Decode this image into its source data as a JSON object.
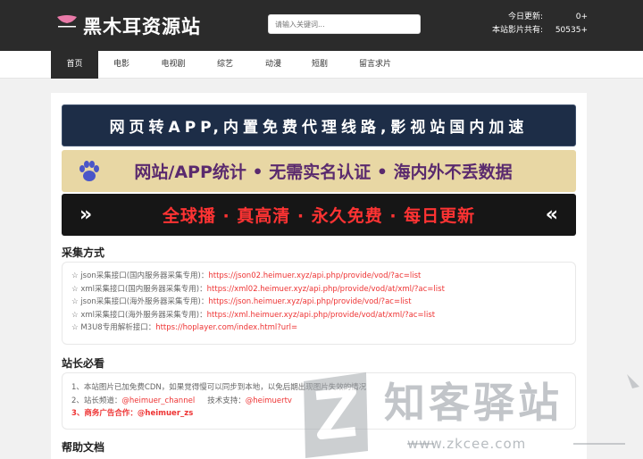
{
  "header": {
    "site_name": "黑木耳资源站",
    "logo_caption": "黑木耳",
    "search_placeholder": "请输入关键词...",
    "stats": [
      {
        "label": "今日更新:",
        "value": "0+"
      },
      {
        "label": "本站影片共有:",
        "value": "50535+"
      }
    ]
  },
  "nav": {
    "items": [
      {
        "label": "首页",
        "active": true
      },
      {
        "label": "电影",
        "active": false
      },
      {
        "label": "电视剧",
        "active": false
      },
      {
        "label": "综艺",
        "active": false
      },
      {
        "label": "动漫",
        "active": false
      },
      {
        "label": "短剧",
        "active": false
      },
      {
        "label": "留言求片",
        "active": false
      }
    ]
  },
  "banners": {
    "b1": "网页转APP,内置免费代理线路,影视站国内加速",
    "b2": "网站/APP统计 • 无需实名认证 • 海内外不丢数据",
    "b3": "全球播 · 真高清 · 永久免费 · 每日更新",
    "b3_left": "»",
    "b3_right": "«"
  },
  "collect": {
    "title": "采集方式",
    "lines": [
      {
        "prefix": "☆ json采集接口(国内服务器采集专用)：",
        "link": "https://json02.heimuer.xyz/api.php/provide/vod/?ac=list"
      },
      {
        "prefix": "☆ xml采集接口(国内服务器采集专用)：",
        "link": "https://xml02.heimuer.xyz/api.php/provide/vod/at/xml/?ac=list"
      },
      {
        "prefix": "☆ json采集接口(海外服务器采集专用)：",
        "link": "https://json.heimuer.xyz/api.php/provide/vod/?ac=list"
      },
      {
        "prefix": "☆ xml采集接口(海外服务器采集专用)：",
        "link": "https://xml.heimuer.xyz/api.php/provide/vod/at/xml/?ac=list"
      },
      {
        "prefix": "☆ M3U8专用解析接口：",
        "link": "https://hoplayer.com/index.html?url="
      }
    ]
  },
  "notice": {
    "title": "站长必看",
    "line1": "1、本站图片已加免费CDN，如果觉得慢可以同步到本地，以免后期出现图片失效的情况",
    "line2_prefix": "2、站长频道：",
    "line2_channel": "@heimuer_channel",
    "line2_mid": "技术支持：",
    "line2_support": "@heimuertv",
    "line3": "3、商务广告合作：@heimuer_zs"
  },
  "help": {
    "title": "帮助文档"
  },
  "watermark": {
    "text": "知客驿站",
    "url": "www.zkcee.com"
  },
  "colors": {
    "header_bg": "#2b2b2b",
    "accent_red": "#e33333",
    "banner1_bg": "#1d2d47",
    "banner2_bg": "#e8d7a4",
    "banner3_bg": "#161616"
  }
}
